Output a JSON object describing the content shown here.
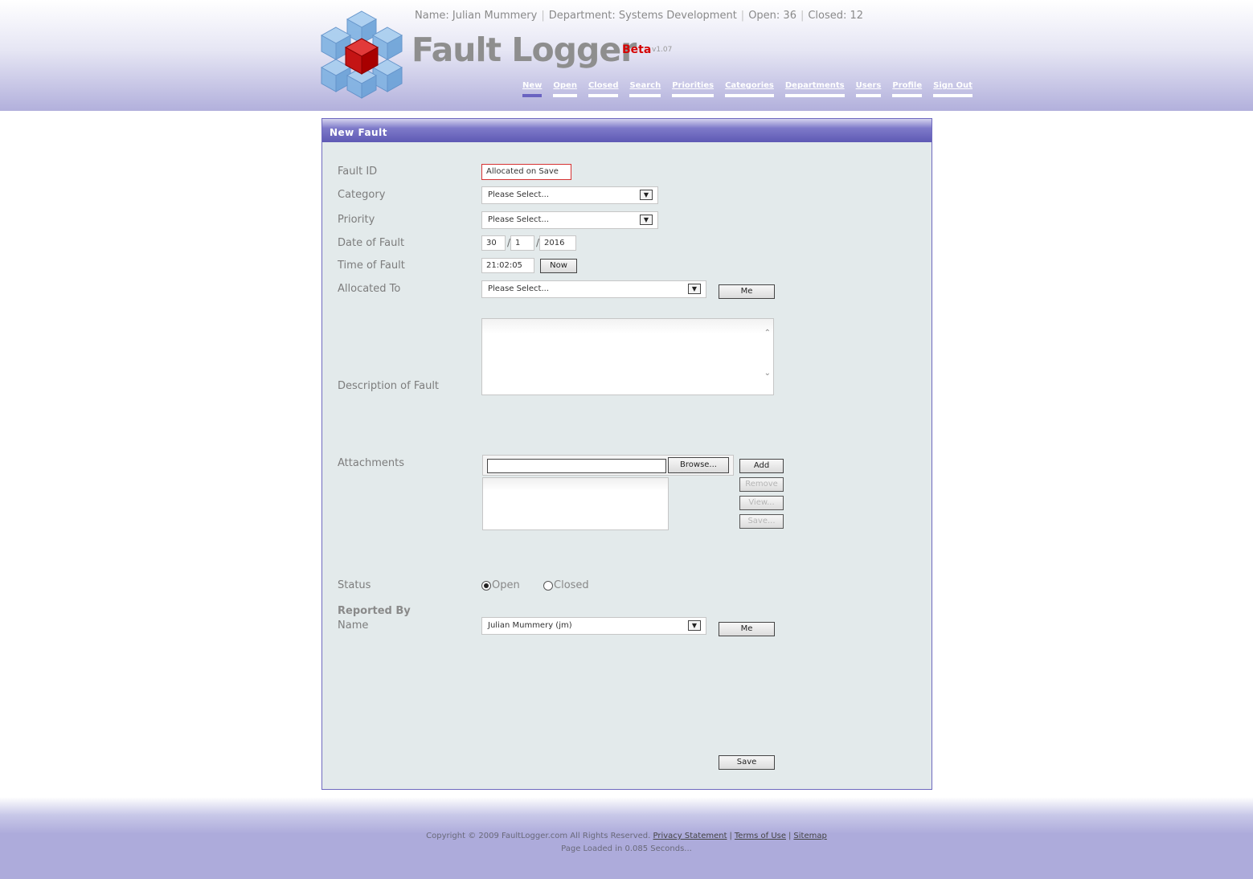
{
  "user_bar": {
    "name": "Name: Julian Mummery",
    "department": "Department: Systems Development",
    "open": "Open: 36",
    "closed": "Closed: 12",
    "separator": "|"
  },
  "app": {
    "title": "Fault Logger",
    "beta": "Beta",
    "version": "v1.07"
  },
  "nav": [
    {
      "label": "New",
      "active": true
    },
    {
      "label": "Open"
    },
    {
      "label": "Closed"
    },
    {
      "label": "Search"
    },
    {
      "label": "Priorities"
    },
    {
      "label": "Categories"
    },
    {
      "label": "Departments"
    },
    {
      "label": "Users"
    },
    {
      "label": "Profile"
    },
    {
      "label": "Sign Out"
    }
  ],
  "panel": {
    "title": "New Fault"
  },
  "form": {
    "fault_id": {
      "label": "Fault ID",
      "value": "Allocated on Save"
    },
    "category": {
      "label": "Category",
      "value": "Please Select..."
    },
    "priority": {
      "label": "Priority",
      "value": "Please Select..."
    },
    "date": {
      "label": "Date of Fault",
      "day": "30",
      "month": "1",
      "year": "2016",
      "separator": "/"
    },
    "time": {
      "label": "Time of Fault",
      "value": "21:02:05",
      "now_button": "Now"
    },
    "allocated_to": {
      "label": "Allocated To",
      "value": "Please Select...",
      "me_button": "Me"
    },
    "description": {
      "label": "Description of Fault",
      "value": ""
    },
    "attachments": {
      "label": "Attachments",
      "browse_button": "Browse...",
      "add_button": "Add",
      "remove_button": "Remove",
      "view_button": "View...",
      "save_button": "Save..."
    },
    "status": {
      "label": "Status",
      "options": [
        "Open",
        "Closed"
      ],
      "selected": "Open"
    },
    "reported_by": {
      "heading": "Reported By",
      "label": "Name",
      "value": "Julian Mummery (jm)",
      "me_button": "Me"
    },
    "save_button": "Save"
  },
  "footer": {
    "copyright": "Copyright © 2009 FaultLogger.com All Rights Reserved.",
    "links": [
      "Privacy Statement",
      "Terms of Use",
      "Sitemap"
    ],
    "separator": "|",
    "load_time": "Page Loaded in 0.085 Seconds..."
  },
  "icons": {
    "logo": "cube-cluster-logo",
    "dropdown": "chevron-down-icon",
    "scroll_up": "chevron-up-icon",
    "scroll_down": "chevron-down-icon"
  },
  "colors": {
    "accent": "#6a63c1",
    "beta": "#d50000",
    "panel_bg": "#e3eaeb",
    "fault_id_border": "#d63333"
  }
}
